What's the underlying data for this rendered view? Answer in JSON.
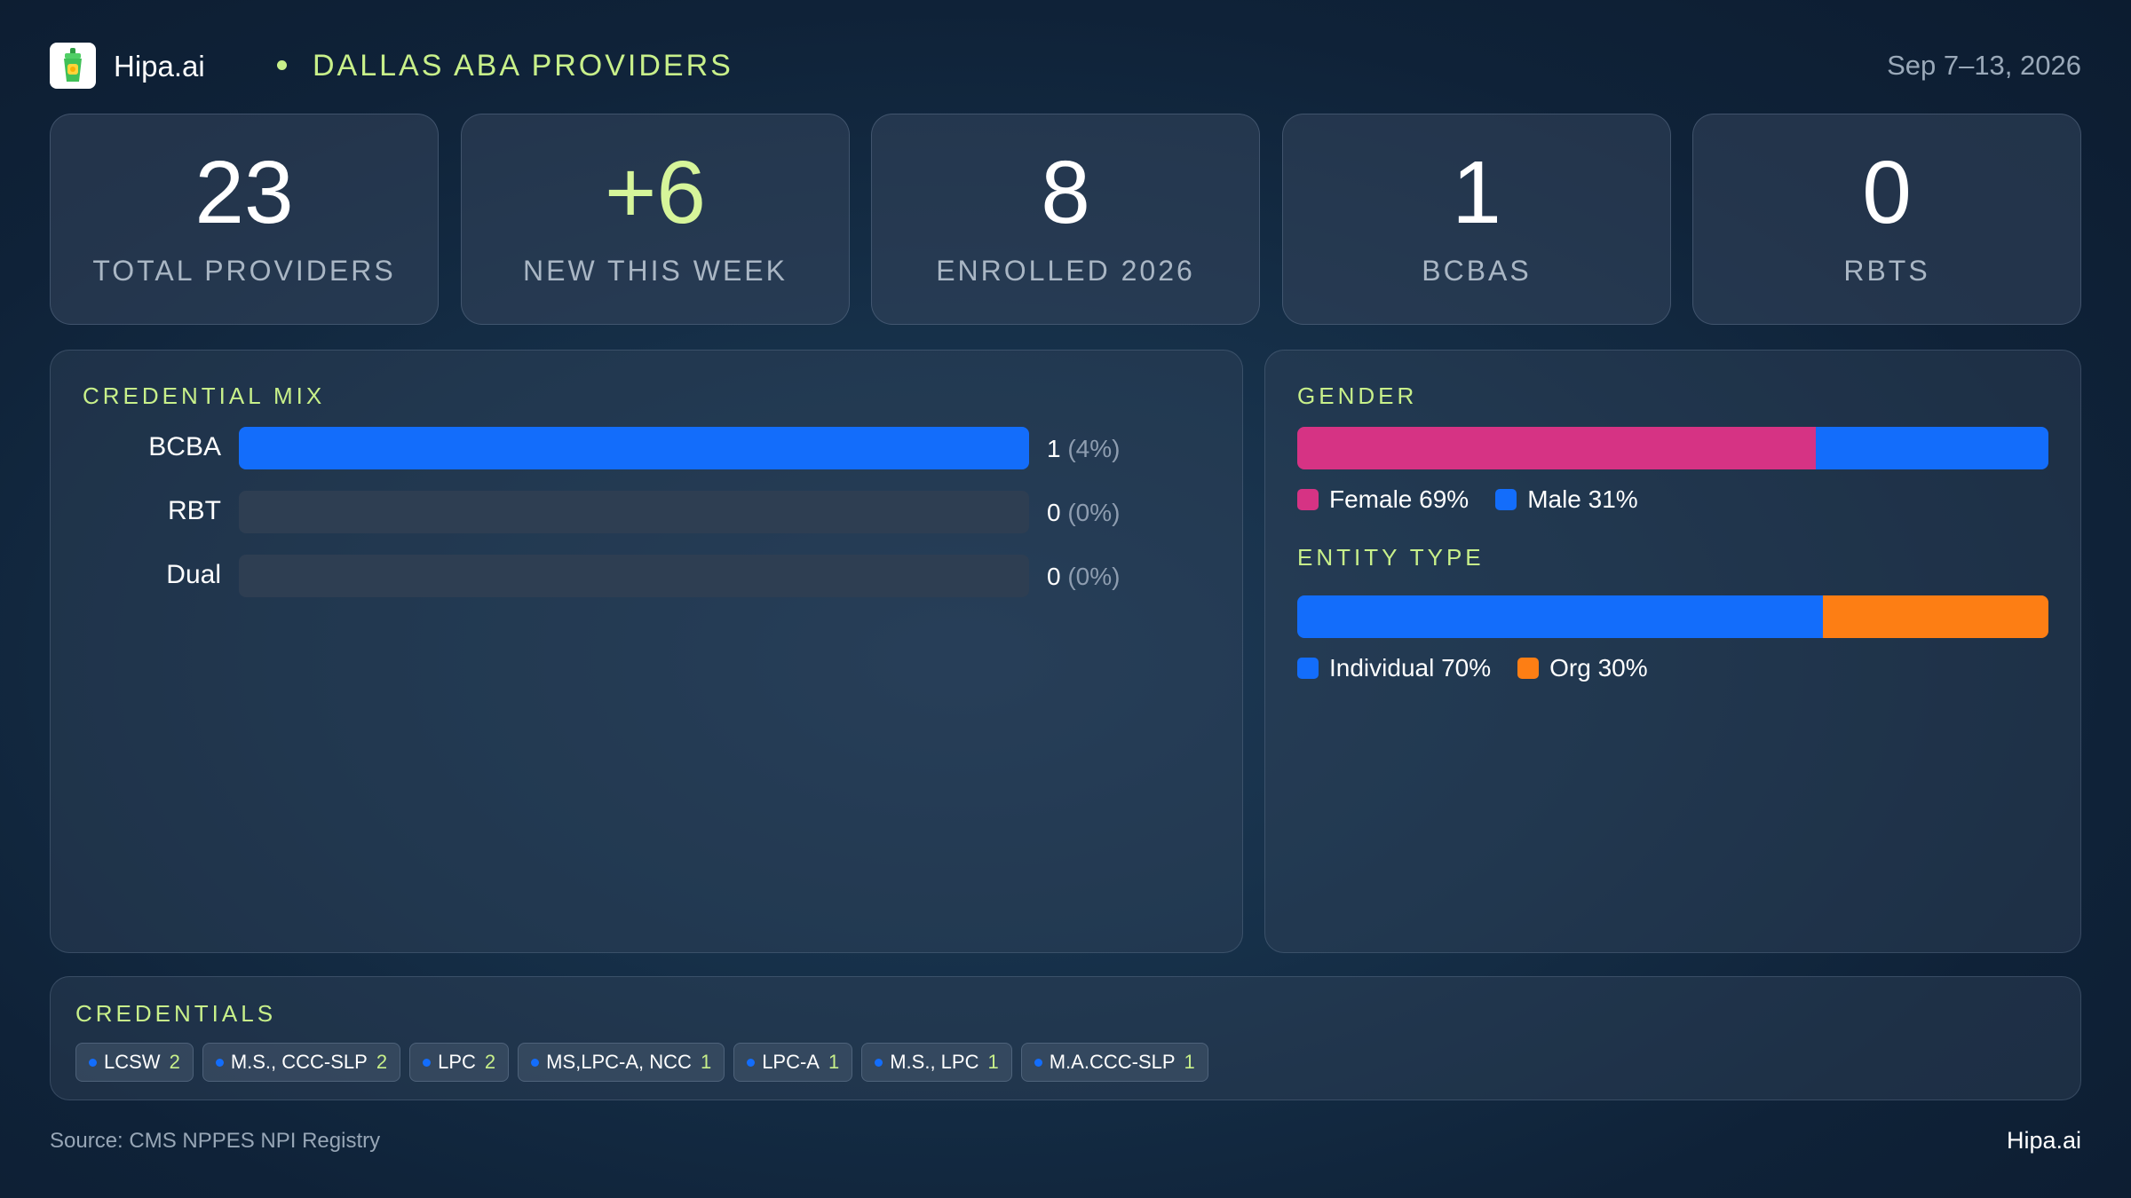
{
  "header": {
    "brand": "Hipa.ai",
    "region": "DALLAS ABA PROVIDERS",
    "date_range": "Sep 7–13, 2026"
  },
  "kpis": [
    {
      "value": "23",
      "label": "TOTAL PROVIDERS"
    },
    {
      "value": "+6",
      "label": "NEW THIS WEEK"
    },
    {
      "value": "8",
      "label": "ENROLLED 2026"
    },
    {
      "value": "1",
      "label": "BCBAS"
    },
    {
      "value": "0",
      "label": "RBTS"
    }
  ],
  "credential_mix": {
    "title": "CREDENTIAL MIX",
    "rows": [
      {
        "label": "BCBA",
        "count": "1",
        "pct": "(4%)",
        "fill_fraction": 1.0
      },
      {
        "label": "RBT",
        "count": "0",
        "pct": "(0%)",
        "fill_fraction": 0.0
      },
      {
        "label": "Dual",
        "count": "0",
        "pct": "(0%)",
        "fill_fraction": 0.0
      }
    ]
  },
  "gender": {
    "title": "GENDER",
    "segments": [
      {
        "label": "Female 69%",
        "fraction": 0.69,
        "color": "#d63384"
      },
      {
        "label": "Male 31%",
        "fraction": 0.31,
        "color": "#136dfb"
      }
    ]
  },
  "entity_type": {
    "title": "ENTITY TYPE",
    "segments": [
      {
        "label": "Individual 70%",
        "fraction": 0.7,
        "color": "#136dfb"
      },
      {
        "label": "Org 30%",
        "fraction": 0.3,
        "color": "#fd7e14"
      }
    ]
  },
  "credentials": {
    "title": "CREDENTIALS",
    "chips": [
      {
        "name": "LCSW",
        "count": "2"
      },
      {
        "name": "M.S., CCC-SLP",
        "count": "2"
      },
      {
        "name": "LPC",
        "count": "2"
      },
      {
        "name": "MS,LPC-A, NCC",
        "count": "1"
      },
      {
        "name": "LPC-A",
        "count": "1"
      },
      {
        "name": "M.S., LPC",
        "count": "1"
      },
      {
        "name": "M.A.CCC-SLP",
        "count": "1"
      }
    ]
  },
  "footer": {
    "source": "Source: CMS NPPES NPI Registry",
    "brand": "Hipa.ai"
  },
  "colors": {
    "accent_green": "#c8f08a",
    "blue": "#136dfb",
    "pink": "#d63384",
    "orange": "#fd7e14"
  }
}
